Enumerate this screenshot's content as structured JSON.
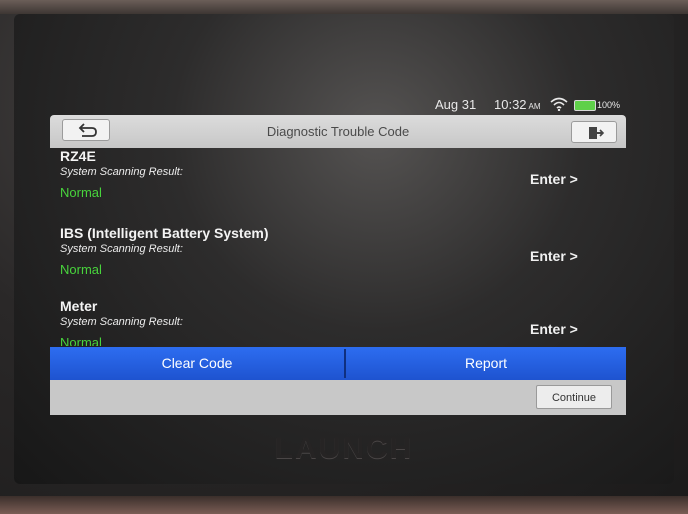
{
  "status_bar": {
    "date": "Aug 31",
    "time": "10:32",
    "ampm": "AM",
    "battery": "100%",
    "icons": {
      "wifi": "wifi-icon",
      "battery": "battery-icon"
    }
  },
  "header": {
    "title": "Diagnostic Trouble Code",
    "back_icon": "back-arrow-icon",
    "exit_icon": "exit-icon"
  },
  "systems": [
    {
      "name": "RZ4E",
      "scan_label": "System Scanning Result:",
      "status": "Normal",
      "enter": "Enter >"
    },
    {
      "name": "IBS (Intelligent Battery System)",
      "scan_label": "System Scanning Result:",
      "status": "Normal",
      "enter": "Enter >"
    },
    {
      "name": "Meter",
      "scan_label": "System Scanning Result:",
      "status": "Normal",
      "enter": "Enter >"
    }
  ],
  "actions": {
    "clear_code": "Clear Code",
    "report": "Report",
    "continue": "Continue"
  },
  "brand": "LAUNCH",
  "colors": {
    "accent": "#1e5ee0",
    "status_ok": "#48d43c",
    "title_bar": "#d0d0d0"
  }
}
